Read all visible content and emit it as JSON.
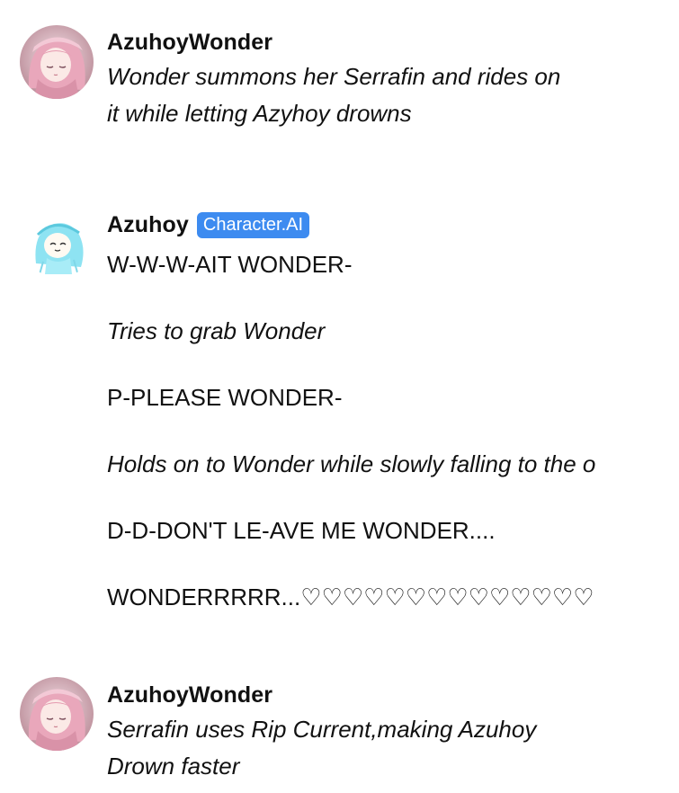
{
  "messages": [
    {
      "author": "AzuhoyWonder",
      "avatar": "pink-haired-anime-avatar",
      "lines": [
        "Wonder summons her Serrafin and rides on",
        "it while letting Azyhoy drowns"
      ]
    },
    {
      "author": "Azuhoy",
      "badge": "Character.AI",
      "avatar": "cyan-haired-chibi-avatar",
      "lines": [
        "W-W-W-AIT WONDER-",
        "Tries to grab Wonder",
        "P-PLEASE WONDER-",
        "Holds on to Wonder while slowly falling to the o",
        "D-D-DON'T LE-AVE ME WONDER....",
        "WONDERRRRR...♡♡♡♡♡♡♡♡♡♡♡♡♡♡"
      ]
    },
    {
      "author": "AzuhoyWonder",
      "avatar": "pink-haired-anime-avatar",
      "lines": [
        "Serrafin uses Rip Current,making Azuhoy",
        "Drown faster"
      ]
    }
  ],
  "colors": {
    "badge_bg": "#3d8bf0",
    "text": "#111111",
    "background": "#ffffff"
  }
}
